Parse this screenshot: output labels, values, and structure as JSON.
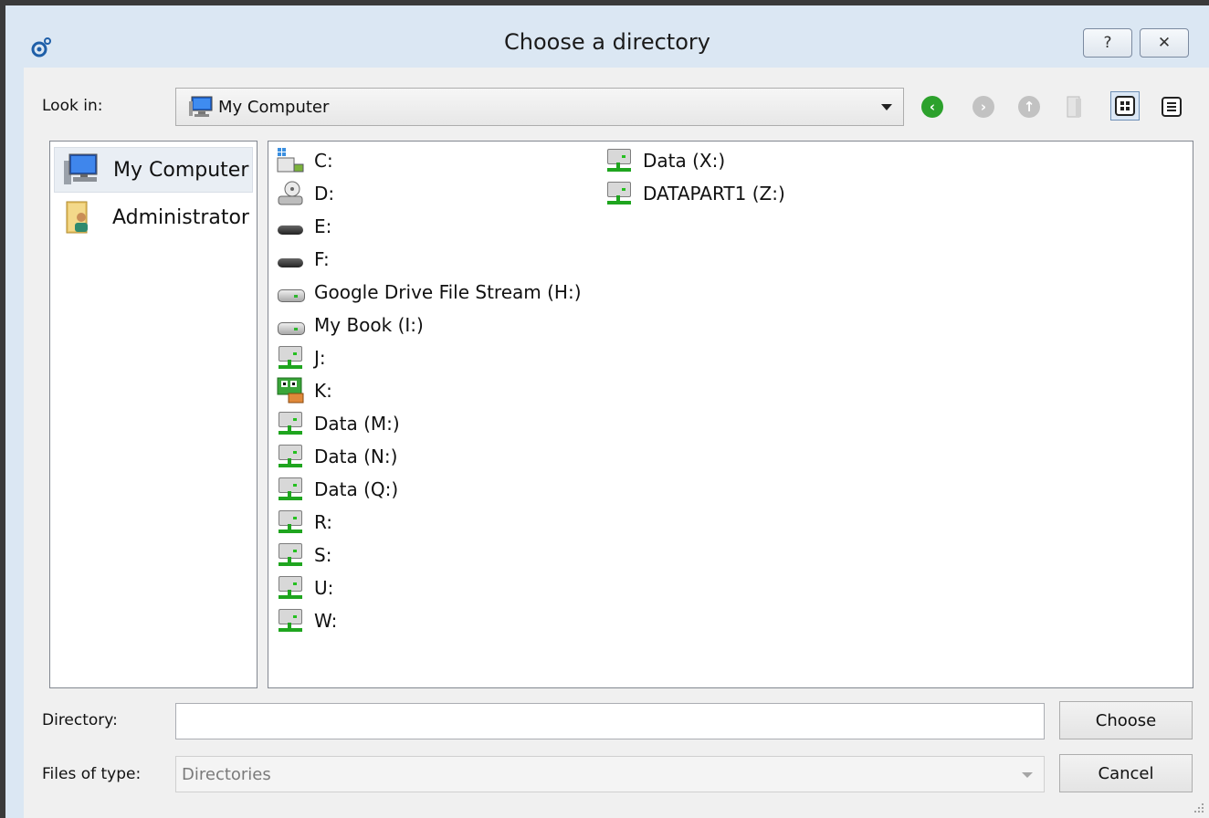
{
  "window": {
    "title": "Choose a directory",
    "help_label": "?",
    "close_label": "✕"
  },
  "lookin": {
    "label": "Look in:",
    "value": "My Computer"
  },
  "toolbar": {
    "back_glyph": "‹",
    "forward_glyph": "›",
    "up_glyph": "↑"
  },
  "sidebar": {
    "items": [
      {
        "label": "My Computer",
        "icon": "computer-icon"
      },
      {
        "label": "Administrator",
        "icon": "user-folder-icon"
      }
    ]
  },
  "files": {
    "col1": [
      {
        "label": "C:",
        "icon": "system-drive-icon"
      },
      {
        "label": "D:",
        "icon": "disc-drive-icon"
      },
      {
        "label": "E:",
        "icon": "optical-drive-icon"
      },
      {
        "label": "F:",
        "icon": "optical-drive-icon"
      },
      {
        "label": "Google Drive File Stream (H:)",
        "icon": "hard-drive-icon"
      },
      {
        "label": "My Book (I:)",
        "icon": "hard-drive-icon"
      },
      {
        "label": "J:",
        "icon": "network-drive-icon"
      },
      {
        "label": "K:",
        "icon": "special-drive-icon"
      },
      {
        "label": "Data (M:)",
        "icon": "network-drive-icon"
      },
      {
        "label": "Data (N:)",
        "icon": "network-drive-icon"
      },
      {
        "label": "Data (Q:)",
        "icon": "network-drive-icon"
      },
      {
        "label": "R:",
        "icon": "network-drive-icon"
      },
      {
        "label": "S:",
        "icon": "network-drive-icon"
      },
      {
        "label": "U:",
        "icon": "network-drive-icon"
      },
      {
        "label": "W:",
        "icon": "network-drive-icon"
      }
    ],
    "col2": [
      {
        "label": "Data (X:)",
        "icon": "network-drive-icon"
      },
      {
        "label": "DATAPART1 (Z:)",
        "icon": "network-drive-icon"
      }
    ]
  },
  "directory": {
    "label": "Directory:",
    "value": ""
  },
  "filetype": {
    "label": "Files of type:",
    "value": "Directories"
  },
  "buttons": {
    "choose": "Choose",
    "cancel": "Cancel"
  },
  "colors": {
    "title_bar": "#dbe7f3",
    "back_button": "#2ca12c",
    "disabled_nav": "#c2c2c2"
  }
}
